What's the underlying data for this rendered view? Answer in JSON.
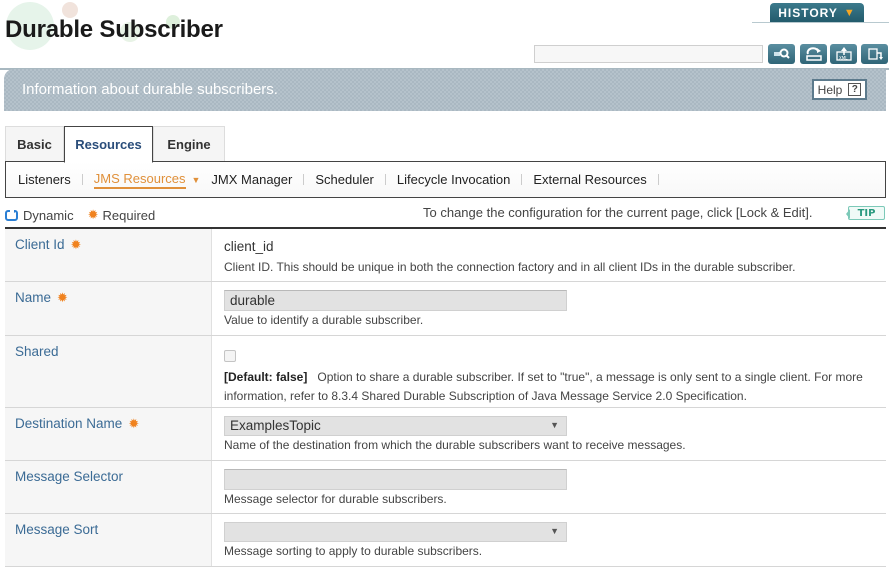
{
  "header": {
    "title": "Durable Subscriber",
    "history_label": "HISTORY",
    "search_placeholder": "",
    "tools": [
      "search-icon",
      "refresh-icon",
      "xml-export-icon",
      "export-icon"
    ]
  },
  "info_bar": {
    "text": "Information about durable subscribers.",
    "help_label": "Help",
    "help_icon": "?"
  },
  "tabs": [
    {
      "label": "Basic",
      "active": false
    },
    {
      "label": "Resources",
      "active": true
    },
    {
      "label": "Engine",
      "active": false
    }
  ],
  "subnav": [
    {
      "label": "Listeners",
      "active": false
    },
    {
      "label": "JMS Resources",
      "active": true
    },
    {
      "label": "JMX Manager",
      "active": false
    },
    {
      "label": "Scheduler",
      "active": false
    },
    {
      "label": "Lifecycle Invocation",
      "active": false
    },
    {
      "label": "External Resources",
      "active": false
    }
  ],
  "legend": {
    "dynamic_label": "Dynamic",
    "required_label": "Required",
    "tip_text": "To change the configuration for the current page, click [Lock & Edit].",
    "tip_badge": "TIP"
  },
  "form": {
    "client_id": {
      "label": "Client Id",
      "required": true,
      "value": "client_id",
      "description": "Client ID. This should be unique in both the connection factory and in all client IDs in the durable subscriber."
    },
    "name": {
      "label": "Name",
      "required": true,
      "value": "durable",
      "description": "Value to identify a durable subscriber."
    },
    "shared": {
      "label": "Shared",
      "required": false,
      "checked": false,
      "default_label": "[Default: false]",
      "description": "Option to share a durable subscriber. If set to \"true\", a message is only sent to a single client. For more information, refer to 8.3.4 Shared Durable Subscription of Java Message Service 2.0 Specification."
    },
    "destination_name": {
      "label": "Destination Name",
      "required": true,
      "value": "ExamplesTopic",
      "description": "Name of the destination from which the durable subscribers want to receive messages."
    },
    "message_selector": {
      "label": "Message Selector",
      "required": false,
      "value": "",
      "description": "Message selector for durable subscribers."
    },
    "message_sort": {
      "label": "Message Sort",
      "required": false,
      "value": "",
      "description": "Message sorting to apply to durable subscribers."
    }
  },
  "colors": {
    "accent_orange": "#e0903a",
    "label_blue": "#3b6b95",
    "required_orange": "#f0821e",
    "info_bar": "#aab8c2",
    "history_teal": "#2b6677"
  }
}
